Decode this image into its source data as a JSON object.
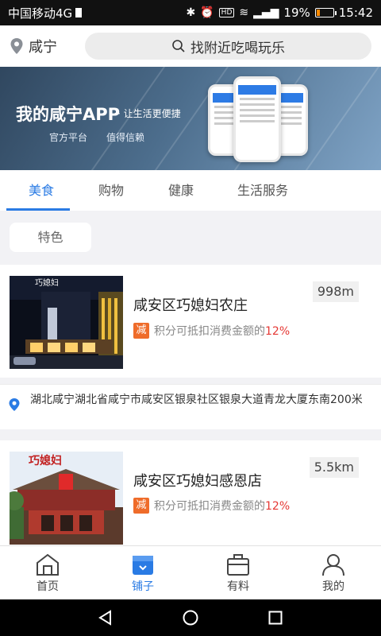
{
  "status_bar": {
    "carrier": "中国移动4G",
    "battery_percent": "19%",
    "battery_level": 0.19,
    "time": "15:42",
    "battery_color": "#ff8a00"
  },
  "header": {
    "city": "咸宁",
    "search_placeholder": "找附近吃喝玩乐"
  },
  "banner": {
    "title": "我的咸宁APP",
    "subtitle": "· 让生活更便捷",
    "tag1": "官方平台",
    "tag2": "值得信赖"
  },
  "tabs": [
    {
      "label": "美食",
      "active": true
    },
    {
      "label": "购物",
      "active": false
    },
    {
      "label": "健康",
      "active": false
    },
    {
      "label": "生活服务",
      "active": false
    }
  ],
  "filter": {
    "chip_label": "特色"
  },
  "shops": [
    {
      "name": "咸安区巧媳妇农庄",
      "distance": "998m",
      "promo_badge": "减",
      "promo_text": "积分可抵扣消费金额的",
      "promo_percent": "12%",
      "address": "湖北咸宁湖北省咸宁市咸安区银泉社区银泉大道青龙大厦东南200米",
      "sign_text": "巧媳妇"
    },
    {
      "name": "咸安区巧媳妇感恩店",
      "distance": "5.5km",
      "promo_badge": "减",
      "promo_text": "积分可抵扣消费金额的",
      "promo_percent": "12%",
      "sign_text": "巧媳妇"
    }
  ],
  "bottom_nav": [
    {
      "label": "首页",
      "icon": "home-icon",
      "active": false
    },
    {
      "label": "铺子",
      "icon": "shop-icon",
      "active": true
    },
    {
      "label": "有料",
      "icon": "briefcase-icon",
      "active": false
    },
    {
      "label": "我的",
      "icon": "user-icon",
      "active": false
    }
  ],
  "colors": {
    "accent": "#2a7be4",
    "promo_badge": "#ef6c2a",
    "promo_percent": "#e53935"
  }
}
